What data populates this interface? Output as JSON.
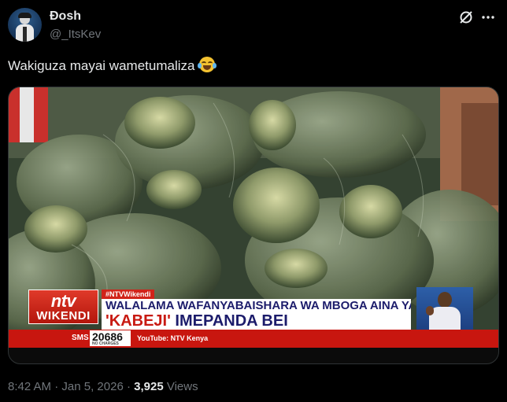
{
  "author": {
    "name": "Đosh",
    "handle": "@_ItsKev"
  },
  "tweet": {
    "text": "Wakiguza mayai wametumaliza",
    "emoji": "face-with-tears-of-joy"
  },
  "media": {
    "hashtag": "#NTVWikendi",
    "logo_top": "ntv",
    "logo_bottom": "WIKENDI",
    "headline_top": "WALALAMA WAFANYABAISHARA WA MBOGA AINA YA CABBAGE",
    "headline_main_part1": "'KABEJI'",
    "headline_main_part2": " IMEPANDA BEI",
    "sms_label": "SMS",
    "sms_number": "20686",
    "sms_note": "NO CHARGES",
    "youtube": "YouTube: NTV Kenya"
  },
  "meta": {
    "time": "8:42 AM",
    "separator1": " · ",
    "date": "Jan 5, 2026",
    "separator2": " · ",
    "views_count": "3,925",
    "views_label": " Views"
  },
  "icons": {
    "grok": "grok-icon",
    "more": "more-icon"
  },
  "colors": {
    "background": "#000000",
    "text": "#e7e9ea",
    "muted": "#71767b",
    "ticker_red": "#c8160f"
  }
}
